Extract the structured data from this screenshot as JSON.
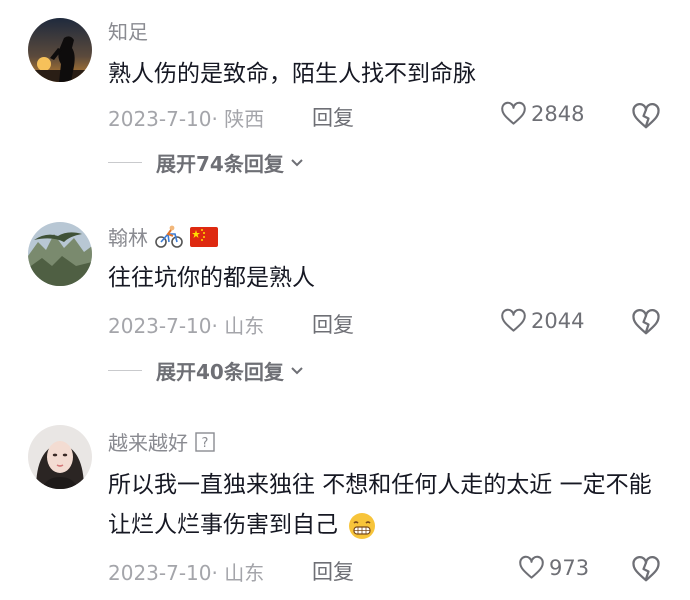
{
  "comments": [
    {
      "username": "知足",
      "text": "熟人伤的是致命，陌生人找不到命脉",
      "date": "2023-7-10",
      "location": "陕西",
      "reply_label": "回复",
      "likes": "2848",
      "expand_label": "展开74条回复"
    },
    {
      "username": "翰林",
      "text": "往往坑你的都是熟人",
      "date": "2023-7-10",
      "location": "山东",
      "reply_label": "回复",
      "likes": "2044",
      "expand_label": "展开40条回复"
    },
    {
      "username": "越来越好",
      "text": "所以我一直独来独往 不想和任何人走的太近 一定不能让烂人烂事伤害到自己",
      "date": "2023-7-10",
      "location": "山东",
      "reply_label": "回复",
      "likes": "973"
    }
  ],
  "icons": {
    "like": "heart-outline-icon",
    "dislike": "broken-heart-icon",
    "expand": "chevron-down-icon"
  },
  "colors": {
    "username": "#8a8b91",
    "text": "#161823",
    "meta": "#a4a5aa",
    "action": "#6e6f75"
  }
}
